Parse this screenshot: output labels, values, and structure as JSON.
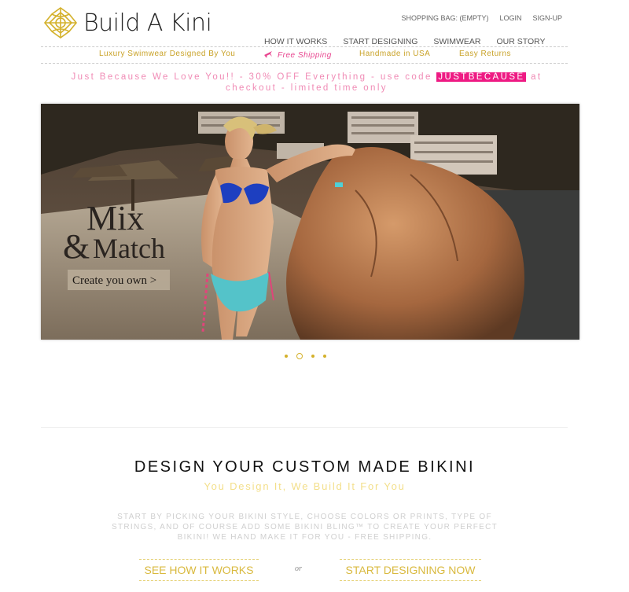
{
  "header": {
    "brand": "Build A Kini",
    "top_links": [
      "SHOPPING BAG: (EMPTY)",
      "LOGIN",
      "SIGN-UP"
    ],
    "nav": [
      "HOW IT WORKS",
      "START DESIGNING",
      "SWIMWEAR",
      "OUR STORY"
    ]
  },
  "perks": {
    "tagline": "Luxury Swimwear Designed By You",
    "shipping": "Free Shipping",
    "handmade": "Handmade in USA",
    "returns": "Easy Returns"
  },
  "promo": {
    "before": "Just Because We Love You!! - 30% OFF Everything - use code ",
    "code": "JUSTBECAUSE",
    "after": " at checkout - limited time only"
  },
  "hero": {
    "title_line1": "Mix",
    "title_amp": "&",
    "title_line2": "Match",
    "cta": "Create you own >",
    "slide_count": 4,
    "active_slide": 2
  },
  "design": {
    "title": "DESIGN YOUR CUSTOM MADE BIKINI",
    "subtitle": "You Design It, We Build It For You",
    "body": "START BY PICKING YOUR BIKINI STYLE, CHOOSE COLORS OR PRINTS, TYPE OF STRINGS, AND OF COURSE ADD SOME BIKINI BLING™ TO CREATE YOUR PERFECT BIKINI! WE HAND MAKE IT FOR YOU - FREE SHIPPING.",
    "btn_how": "SEE HOW IT WORKS",
    "or": "or",
    "btn_start": "START DESIGNING NOW"
  },
  "colors": {
    "gold": "#d4b12b",
    "pink": "#ee1a83",
    "promo_text": "#f08bb5"
  }
}
